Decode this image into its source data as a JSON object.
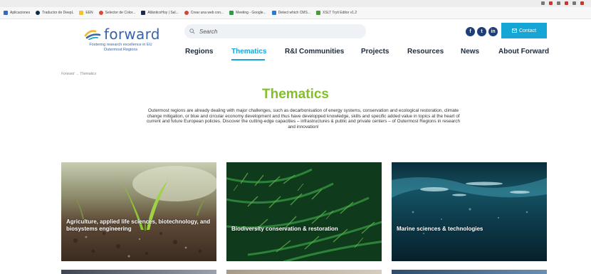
{
  "bookmarks": [
    {
      "label": "Aplicaciones",
      "color": "#3a66c4"
    },
    {
      "label": "Traductor de DeepL",
      "color": "#0f2b46"
    },
    {
      "label": "EEN",
      "color": "#f2c230"
    },
    {
      "label": "Selector de Color...",
      "color": "#d94a3a"
    },
    {
      "label": "AtlánticoHoy | Sal...",
      "color": "#1c2a4d"
    },
    {
      "label": "Crear una web con...",
      "color": "#d6453a"
    },
    {
      "label": "Meeting - Google...",
      "color": "#2d9c4a"
    },
    {
      "label": "Detect which CMS...",
      "color": "#2a7ad1"
    },
    {
      "label": "XSLT Tryit Editor v1.2",
      "color": "#4a9a3a"
    }
  ],
  "header": {
    "logo_text": "forward",
    "tagline": "Fostering research excellence in EU Outermost Regions",
    "search_placeholder": "Search",
    "social": [
      "f",
      "t",
      "in"
    ],
    "contact_label": "Contact"
  },
  "nav": {
    "items": [
      {
        "label": "Regions",
        "active": false
      },
      {
        "label": "Thematics",
        "active": true
      },
      {
        "label": "R&I Communities",
        "active": false
      },
      {
        "label": "Projects",
        "active": false
      },
      {
        "label": "Resources",
        "active": false
      },
      {
        "label": "News",
        "active": false
      },
      {
        "label": "About Forward",
        "active": false
      }
    ]
  },
  "breadcrumb": "Forward → Thematics",
  "page": {
    "title": "Thematics",
    "intro": "Outermost regions are already dealing with major challenges, such as decarbonisation of energy systems, conservation and ecological restoration, climate change mitigation, or blue and circular economy development and thus have developped knowledge, skills and specific added value in topics at the heart of current and future European policies. Discover the cutting-edge capacities – infrastructures & public and private centers – of Outermost Regions in research and innovation!"
  },
  "cards": [
    {
      "label": "Agriculture, applied life sciences, biotechnology, and biosystems engineering"
    },
    {
      "label": "Biodiversity conservation & restoration"
    },
    {
      "label": "Marine sciences & technologies"
    }
  ],
  "colors": {
    "brand_blue": "#3a63a8",
    "accent_cyan": "#16a6d6",
    "title_green": "#84bf2b",
    "nav_dark": "#1d2a3a"
  }
}
